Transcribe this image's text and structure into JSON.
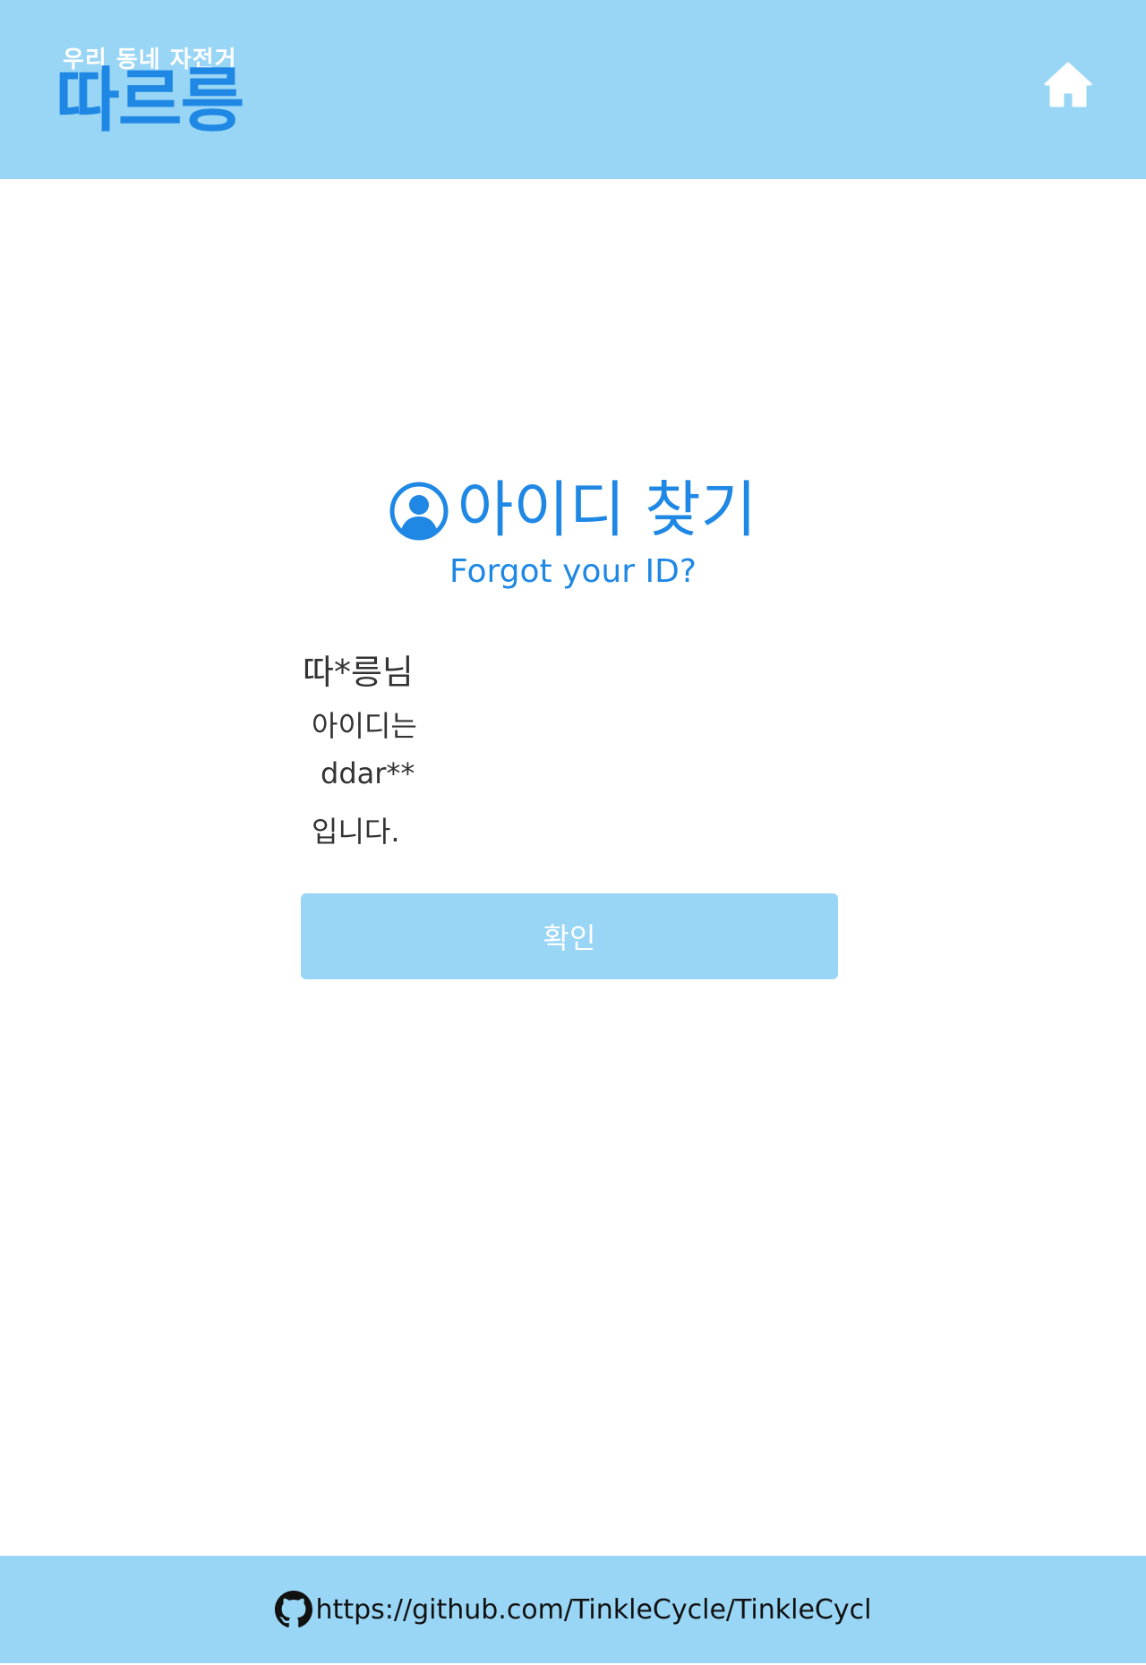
{
  "header": {
    "logo_tagline": "우리 동네 자전거",
    "logo_title": "따르릉",
    "home_icon": "home-icon"
  },
  "main": {
    "title_icon": "user-circle-icon",
    "title": "아이디 찾기",
    "subtitle": "Forgot your ID?",
    "result": {
      "name": "따*릉님",
      "line1": "아이디는",
      "id_value": "ddar**",
      "line3": "입니다."
    },
    "confirm_label": "확인"
  },
  "footer": {
    "icon": "github-icon",
    "url": "https://github.com/TinkleCycle/TinkleCycl"
  },
  "colors": {
    "header_bg": "#99d5f4",
    "accent": "#1f88e5",
    "button_bg": "#99d5f4"
  }
}
